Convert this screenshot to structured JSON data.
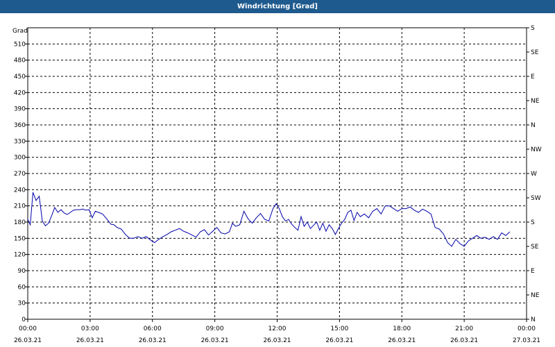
{
  "window": {
    "title": "Windrichtung [Grad]"
  },
  "chart_data": {
    "type": "line",
    "title": "Windrichtung [Grad]",
    "ylabel": "Grad",
    "xlabel": "",
    "ylim": [
      0,
      540
    ],
    "xlim_hours": [
      0,
      24
    ],
    "grid": true,
    "y_ticks": [
      0,
      30,
      60,
      90,
      120,
      150,
      180,
      210,
      240,
      270,
      300,
      330,
      360,
      390,
      420,
      450,
      480,
      510
    ],
    "y_right_ticks": [
      {
        "value": 0,
        "label": "N"
      },
      {
        "value": 45,
        "label": "NE"
      },
      {
        "value": 90,
        "label": "E"
      },
      {
        "value": 135,
        "label": "SE"
      },
      {
        "value": 180,
        "label": "S"
      },
      {
        "value": 225,
        "label": "SW"
      },
      {
        "value": 270,
        "label": "W"
      },
      {
        "value": 315,
        "label": "NW"
      },
      {
        "value": 360,
        "label": "N"
      },
      {
        "value": 405,
        "label": "NE"
      },
      {
        "value": 450,
        "label": "E"
      },
      {
        "value": 495,
        "label": "SE"
      },
      {
        "value": 540,
        "label": "S"
      }
    ],
    "x_ticks": [
      {
        "hour": 0,
        "time": "00:00",
        "date": "26.03.21"
      },
      {
        "hour": 3,
        "time": "03:00",
        "date": "26.03.21"
      },
      {
        "hour": 6,
        "time": "06:00",
        "date": "26.03.21"
      },
      {
        "hour": 9,
        "time": "09:00",
        "date": "26.03.21"
      },
      {
        "hour": 12,
        "time": "12:00",
        "date": "26.03.21"
      },
      {
        "hour": 15,
        "time": "15:00",
        "date": "26.03.21"
      },
      {
        "hour": 18,
        "time": "18:00",
        "date": "26.03.21"
      },
      {
        "hour": 21,
        "time": "21:00",
        "date": "26.03.21"
      },
      {
        "hour": 24,
        "time": "00:00",
        "date": "27.03.21"
      }
    ],
    "colors": {
      "line": "#0000aa",
      "grid": "#000000",
      "title_bar": "#1f5a8e"
    },
    "series": [
      {
        "x_hours": [
          0.0,
          0.12,
          0.25,
          0.4,
          0.55,
          0.7,
          0.85,
          1.0,
          1.15,
          1.3,
          1.45,
          1.6,
          1.75,
          1.9,
          2.05,
          2.2,
          2.35,
          2.5,
          2.65,
          2.8,
          2.95,
          3.1,
          3.25,
          3.4,
          3.6,
          3.8,
          4.0,
          4.15,
          4.3,
          4.5,
          4.7,
          4.9,
          5.1,
          5.3,
          5.5,
          5.7,
          5.9,
          6.1,
          6.3,
          6.5,
          6.7,
          6.9,
          7.1,
          7.3,
          7.5,
          7.7,
          7.9,
          8.1,
          8.3,
          8.5,
          8.7,
          8.9,
          9.1,
          9.3,
          9.5,
          9.7,
          9.85,
          10.0,
          10.2,
          10.4,
          10.6,
          10.8,
          11.0,
          11.2,
          11.4,
          11.6,
          11.8,
          11.95,
          12.1,
          12.25,
          12.4,
          12.55,
          12.7,
          12.85,
          13.0,
          13.15,
          13.3,
          13.45,
          13.6,
          13.75,
          13.9,
          14.05,
          14.2,
          14.35,
          14.5,
          14.65,
          14.8,
          14.95,
          15.1,
          15.25,
          15.4,
          15.55,
          15.7,
          15.85,
          16.0,
          16.2,
          16.4,
          16.6,
          16.8,
          17.0,
          17.2,
          17.4,
          17.6,
          17.8,
          18.0,
          18.2,
          18.4,
          18.6,
          18.8,
          19.0,
          19.2,
          19.4,
          19.6,
          19.8,
          20.0,
          20.2,
          20.4,
          20.6,
          20.8,
          21.0,
          21.2,
          21.4,
          21.6,
          21.8,
          22.0,
          22.2,
          22.4,
          22.6,
          22.8,
          23.0,
          23.2,
          23.4,
          23.6,
          23.8,
          23.95
        ],
        "values": [
          185,
          175,
          235,
          220,
          228,
          182,
          173,
          178,
          192,
          207,
          198,
          203,
          197,
          194,
          198,
          202,
          203,
          203,
          204,
          202,
          203,
          188,
          200,
          198,
          195,
          186,
          176,
          175,
          170,
          167,
          157,
          150,
          150,
          153,
          150,
          153,
          147,
          142,
          148,
          153,
          157,
          162,
          165,
          168,
          163,
          160,
          156,
          152,
          162,
          166,
          156,
          163,
          170,
          160,
          158,
          162,
          178,
          172,
          175,
          200,
          186,
          178,
          188,
          196,
          185,
          182,
          205,
          214,
          205,
          190,
          182,
          185,
          176,
          170,
          165,
          190,
          172,
          180,
          168,
          174,
          180,
          165,
          178,
          163,
          175,
          168,
          157,
          168,
          178,
          185,
          198,
          202,
          183,
          198,
          190,
          195,
          188,
          200,
          205,
          195,
          210,
          210,
          205,
          200,
          205,
          205,
          208,
          202,
          198,
          204,
          200,
          195,
          170,
          167,
          158,
          142,
          135,
          148,
          140,
          135,
          145,
          150,
          155,
          150,
          152,
          148,
          153,
          148,
          160,
          155,
          162
        ]
      }
    ]
  }
}
